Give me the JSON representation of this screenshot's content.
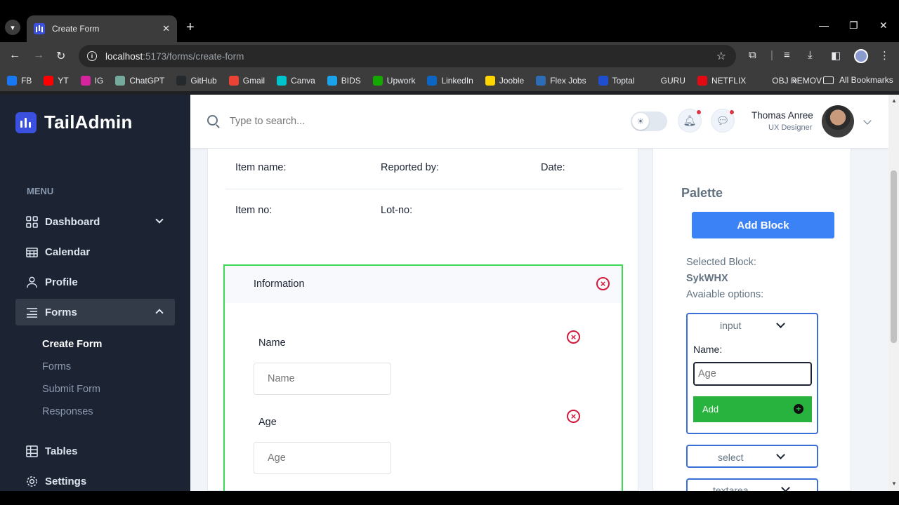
{
  "browser": {
    "tab_title": "Create Form",
    "url_host": "localhost",
    "url_path": ":5173/forms/create-form",
    "bookmarks": [
      {
        "label": "FB",
        "color": "#1877f2"
      },
      {
        "label": "YT",
        "color": "#ff0000"
      },
      {
        "label": "IG",
        "color": "#d6249f"
      },
      {
        "label": "ChatGPT",
        "color": "#74aa9c"
      },
      {
        "label": "GitHub",
        "color": "#24292e"
      },
      {
        "label": "Gmail",
        "color": "#ea4335"
      },
      {
        "label": "Canva",
        "color": "#00c4cc"
      },
      {
        "label": "BIDS",
        "color": "#1aa3e8"
      },
      {
        "label": "Upwork",
        "color": "#14a800"
      },
      {
        "label": "LinkedIn",
        "color": "#0a66c2"
      },
      {
        "label": "Jooble",
        "color": "#ffd500"
      },
      {
        "label": "Flex Jobs",
        "color": "#2d6db5"
      },
      {
        "label": "Toptal",
        "color": "#204ecf"
      },
      {
        "label": "GURU",
        "color": "#3c3c3c"
      },
      {
        "label": "NETFLIX",
        "color": "#e50914"
      },
      {
        "label": "OBJ REMOV",
        "color": "#3c3c3c"
      }
    ],
    "all_bookmarks": "All Bookmarks"
  },
  "sidebar": {
    "brand": "TailAdmin",
    "menu_heading": "MENU",
    "items": {
      "dashboard": "Dashboard",
      "calendar": "Calendar",
      "profile": "Profile",
      "forms": "Forms",
      "tables": "Tables",
      "settings": "Settings"
    },
    "forms_sub": {
      "create_form": "Create Form",
      "forms": "Forms",
      "submit_form": "Submit Form",
      "responses": "Responses"
    }
  },
  "header": {
    "search_placeholder": "Type to search...",
    "user_name": "Thomas Anree",
    "user_role": "UX Designer"
  },
  "form": {
    "item_name": "Item name:",
    "reported_by": "Reported by:",
    "date": "Date:",
    "item_no": "Item no:",
    "lot_no": "Lot-no:",
    "block_title": "Information",
    "fields": [
      {
        "label": "Name",
        "placeholder": "Name"
      },
      {
        "label": "Age",
        "placeholder": "Age"
      }
    ]
  },
  "palette": {
    "title": "Palette",
    "add_block": "Add Block",
    "selected_label": "Selected Block:",
    "selected_value": "SykWHX",
    "options_label": "Avaiable options:",
    "options": [
      {
        "name": "input"
      },
      {
        "name": "select"
      },
      {
        "name": "textarea"
      }
    ],
    "input_name_label": "Name:",
    "input_value": "Age",
    "add_label": "Add"
  },
  "colors": {
    "sidebar_bg": "#1c2434",
    "accent_blue": "#3b82f6",
    "block_border_green": "#3cd856",
    "add_green": "#28b33f",
    "remove_red": "#d3193c"
  }
}
